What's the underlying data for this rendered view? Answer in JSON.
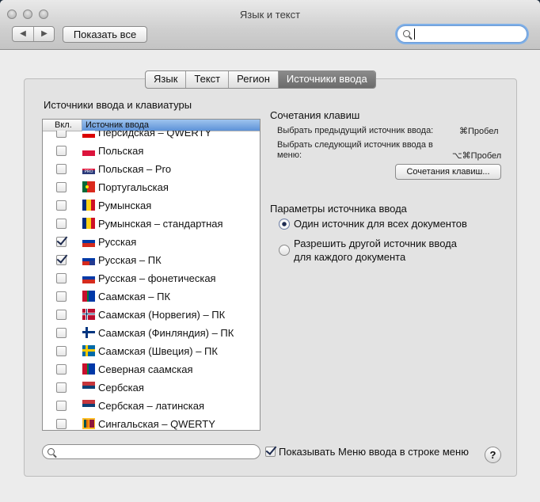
{
  "window": {
    "title": "Язык и текст"
  },
  "toolbar": {
    "back": "◀",
    "forward": "▶",
    "show_all": "Показать все",
    "search_value": ""
  },
  "tabs": [
    {
      "label": "Язык",
      "active": false
    },
    {
      "label": "Текст",
      "active": false
    },
    {
      "label": "Регион",
      "active": false
    },
    {
      "label": "Источники ввода",
      "active": true
    }
  ],
  "sources": {
    "heading": "Источники ввода и клавиатуры",
    "col_enabled": "Вкл.",
    "col_source": "Источник ввода",
    "items": [
      {
        "label": "Персидская – QWERTY",
        "checked": false,
        "flag": "ir"
      },
      {
        "label": "Польская",
        "checked": false,
        "flag": "pl"
      },
      {
        "label": "Польская – Pro",
        "checked": false,
        "flag": "pl-pro"
      },
      {
        "label": "Португальская",
        "checked": false,
        "flag": "pt"
      },
      {
        "label": "Румынская",
        "checked": false,
        "flag": "ro"
      },
      {
        "label": "Румынская – стандартная",
        "checked": false,
        "flag": "ro"
      },
      {
        "label": "Русская",
        "checked": true,
        "flag": "ru"
      },
      {
        "label": "Русская – ПК",
        "checked": true,
        "flag": "ru-pc"
      },
      {
        "label": "Русская – фонетическая",
        "checked": false,
        "flag": "ru"
      },
      {
        "label": "Саамская – ПК",
        "checked": false,
        "flag": "sami"
      },
      {
        "label": "Саамская (Норвегия) – ПК",
        "checked": false,
        "flag": "no"
      },
      {
        "label": "Саамская (Финляндия) – ПК",
        "checked": false,
        "flag": "fi"
      },
      {
        "label": "Саамская (Швеция) – ПК",
        "checked": false,
        "flag": "se"
      },
      {
        "label": "Северная саамская",
        "checked": false,
        "flag": "sami"
      },
      {
        "label": "Сербская",
        "checked": false,
        "flag": "rs"
      },
      {
        "label": "Сербская – латинская",
        "checked": false,
        "flag": "rs"
      },
      {
        "label": "Сингальская – QWERTY",
        "checked": false,
        "flag": "lk"
      }
    ]
  },
  "shortcuts": {
    "heading": "Сочетания клавиш",
    "prev_label": "Выбрать предыдущий источник ввода:",
    "prev_keys": "⌘Пробел",
    "next_label_1": "Выбрать следующий источник ввода в",
    "next_label_2": "меню:",
    "next_keys": "⌥⌘Пробел",
    "button": "Сочетания клавиш..."
  },
  "params": {
    "heading": "Параметры источника ввода",
    "option1": "Один источник для всех документов",
    "option2_line1": "Разрешить другой источник ввода",
    "option2_line2": "для каждого документа",
    "selected": 1
  },
  "bottom": {
    "search_value": "",
    "show_menu_label": "Показывать Меню ввода в строке меню",
    "show_menu_checked": true,
    "help": "?"
  }
}
